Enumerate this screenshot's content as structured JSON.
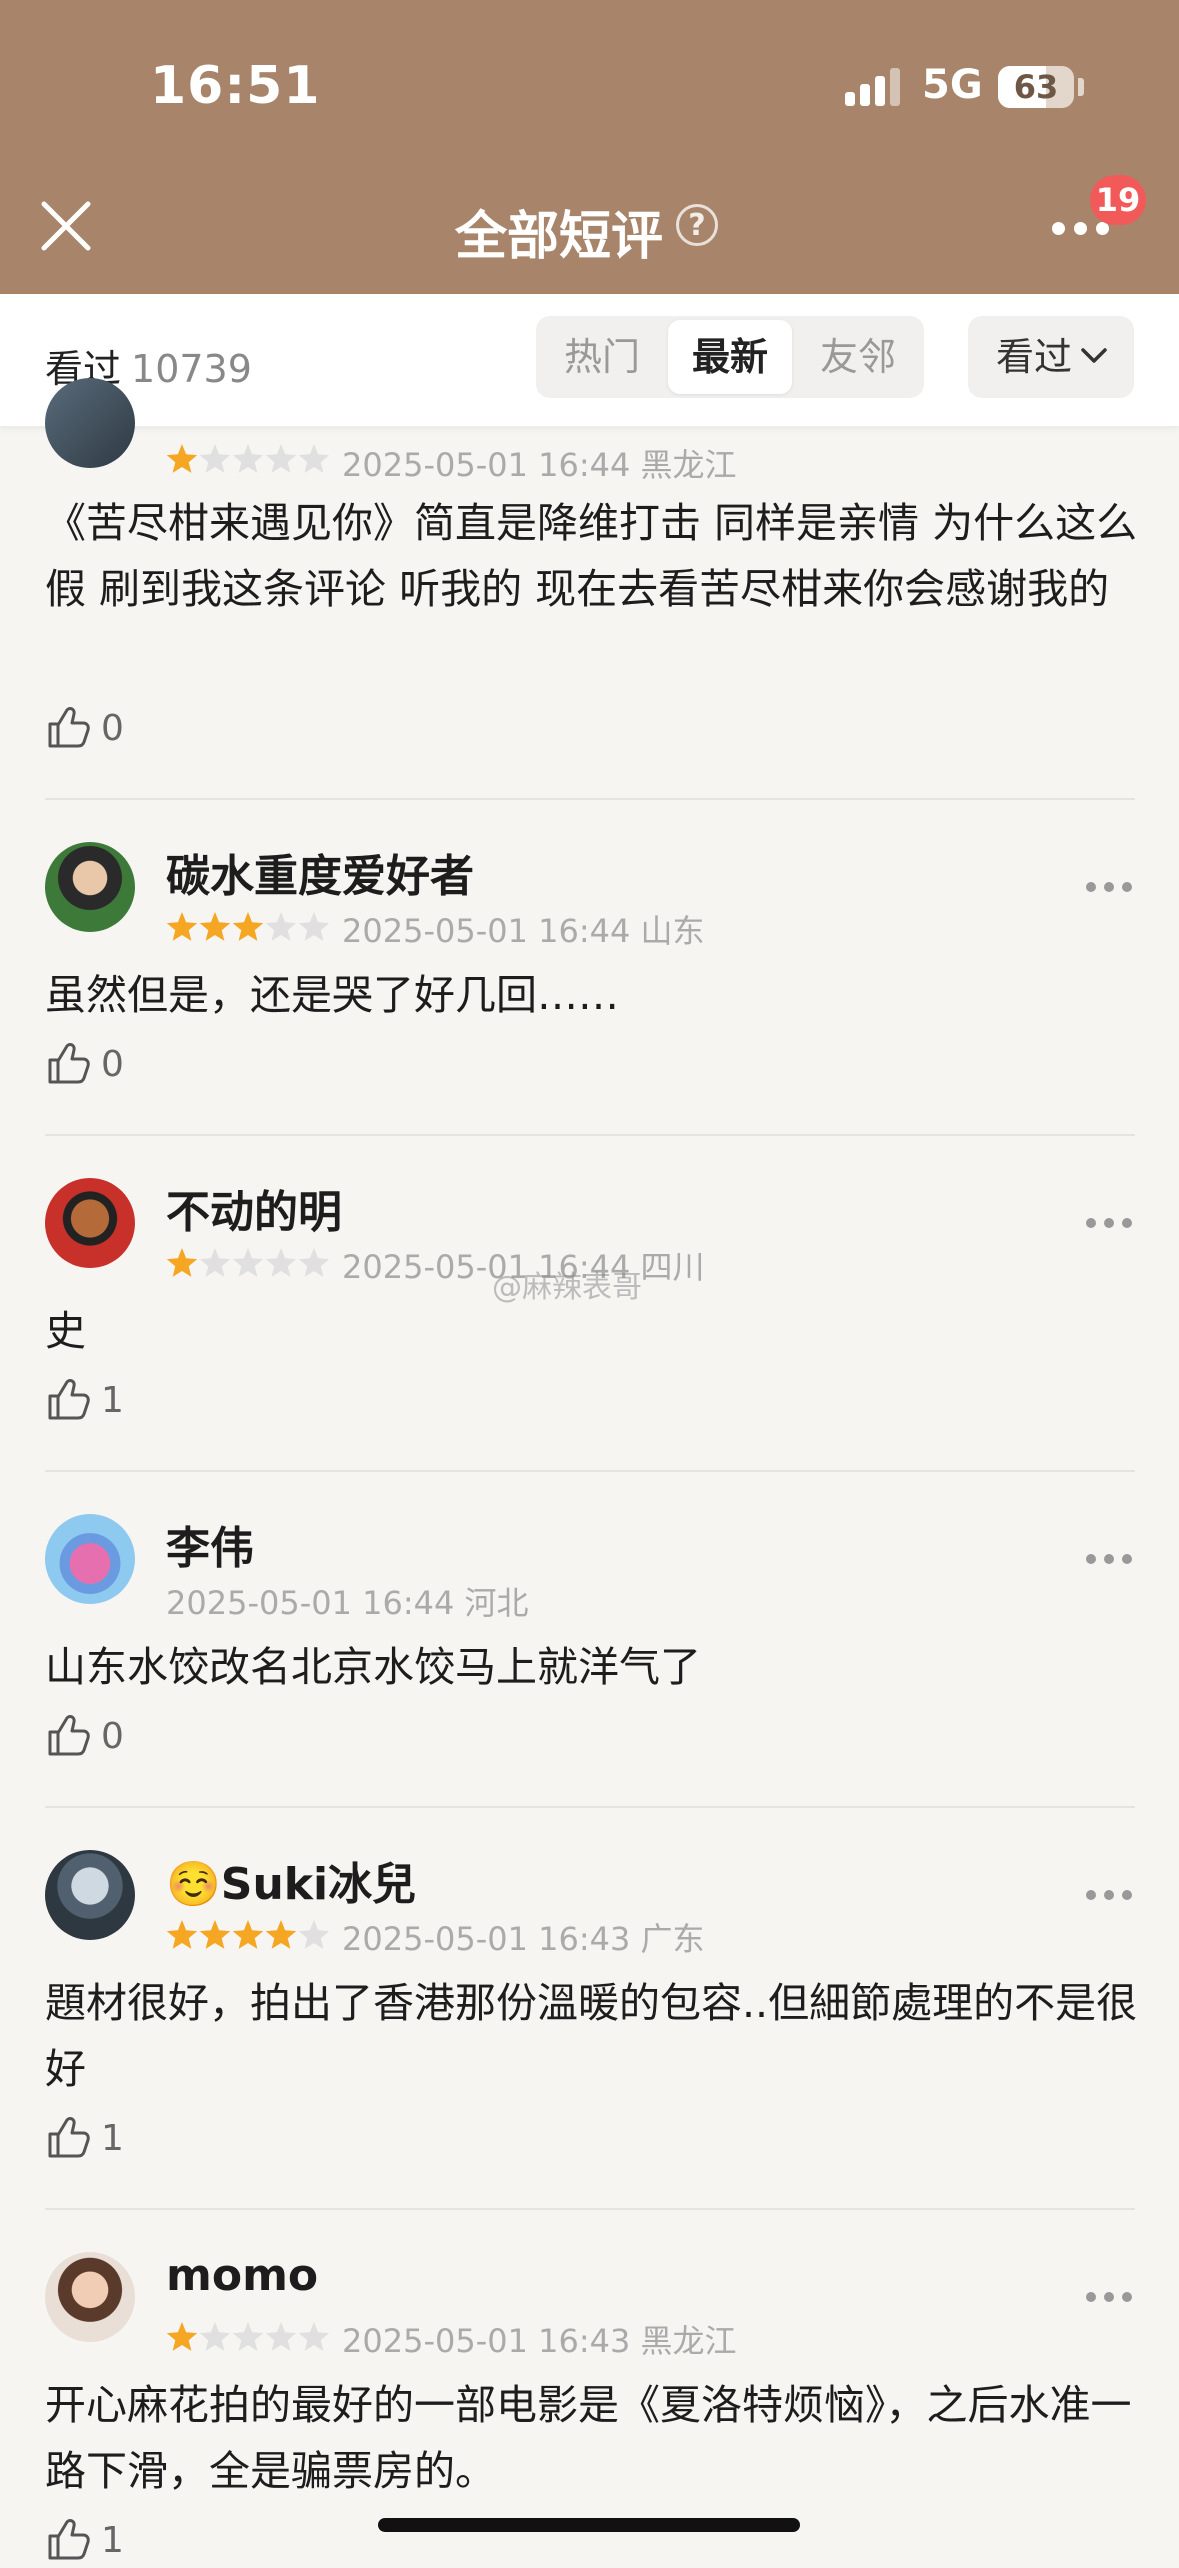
{
  "status_bar": {
    "time": "16:51",
    "network": "5G",
    "battery": "63"
  },
  "header": {
    "title": "全部短评",
    "help_icon": "question-circle-icon",
    "notification_count": "19"
  },
  "filter": {
    "seen_label": "看过",
    "seen_count": "10739",
    "tabs": [
      {
        "label": "热门",
        "active": false
      },
      {
        "label": "最新",
        "active": true
      },
      {
        "label": "友邻",
        "active": false
      }
    ],
    "dropdown_label": "看过"
  },
  "comments": [
    {
      "username": "",
      "rating": 1,
      "date": "2025-05-01 16:44",
      "region": "黑龙江",
      "text": "《苦尽柑来遇见你》简直是降维打击 同样是亲情 为什么这么假 刷到我这条评论 听我的 现在去看苦尽柑来你会感谢我的",
      "likes": "0"
    },
    {
      "username": "碳水重度爱好者",
      "rating": 3,
      "date": "2025-05-01 16:44",
      "region": "山东",
      "text": "虽然但是，还是哭了好几回……",
      "likes": "0"
    },
    {
      "username": "不动的明",
      "rating": 1,
      "date": "2025-05-01 16:44",
      "region": "四川",
      "text": "史",
      "likes": "1"
    },
    {
      "username": "李伟",
      "rating": 0,
      "date": "2025-05-01 16:44",
      "region": "河北",
      "text": "山东水饺改名北京水饺马上就洋气了",
      "likes": "0"
    },
    {
      "username": "☺️Suki冰兒",
      "rating": 4,
      "date": "2025-05-01 16:43",
      "region": "广东",
      "text": "題材很好，拍出了香港那份溫暖的包容..但細節處理的不是很好",
      "likes": "1"
    },
    {
      "username": "momo",
      "rating": 1,
      "date": "2025-05-01 16:43",
      "region": "黑龙江",
      "text": "开心麻花拍的最好的一部电影是《夏洛特烦恼》，之后水准一路下滑，全是骗票房的。",
      "likes": "1"
    }
  ],
  "watermark": "@麻辣表哥",
  "colors": {
    "header_bg": "#a8856a",
    "star_on": "#f5a623",
    "star_off": "#e0e0e0",
    "badge": "#f25a5a"
  }
}
